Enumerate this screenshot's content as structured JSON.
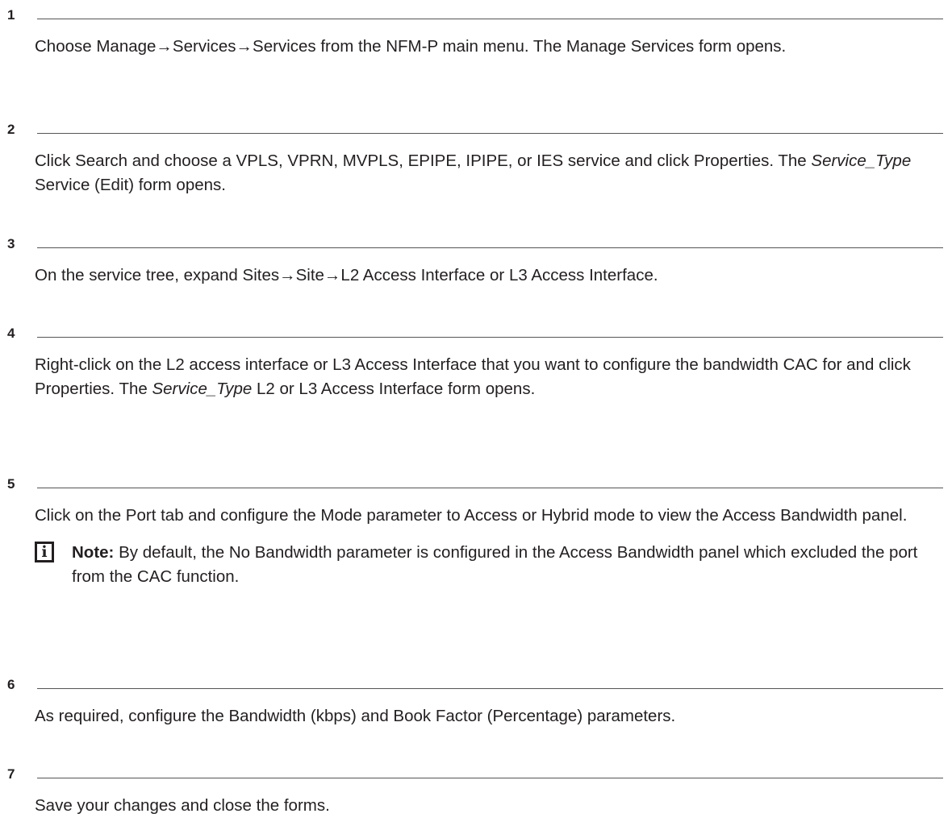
{
  "steps": [
    {
      "number": "1",
      "text": "Choose Manage→Services→Services from the NFM-P main menu. The Manage Services form opens."
    },
    {
      "number": "2",
      "text_a": "Click Search and choose a VPLS, VPRN, MVPLS, EPIPE, IPIPE, or IES service and click Properties. The ",
      "italic": "Service_Type",
      "text_b": " Service (Edit) form opens."
    },
    {
      "number": "3",
      "text": "On the service tree, expand Sites→Site→L2 Access Interface or L3 Access Interface."
    },
    {
      "number": "4",
      "text_a": "Right-click on the L2 access interface or L3 Access Interface that you want to configure the bandwidth CAC for and click Properties. The ",
      "italic": "Service_Type",
      "text_b": " L2 or L3 Access Interface form opens."
    },
    {
      "number": "5",
      "text": "Click on the Port tab and configure the Mode parameter to Access or Hybrid mode to view the Access Bandwidth panel.",
      "note": {
        "icon": "i",
        "label": "Note:",
        "text": " By default, the No Bandwidth parameter is configured in the Access Bandwidth panel which excluded the port from the CAC function."
      }
    },
    {
      "number": "6",
      "text": "As required, configure the Bandwidth (kbps) and Book Factor (Percentage) parameters."
    },
    {
      "number": "7",
      "text": "Save your changes and close the forms."
    }
  ]
}
